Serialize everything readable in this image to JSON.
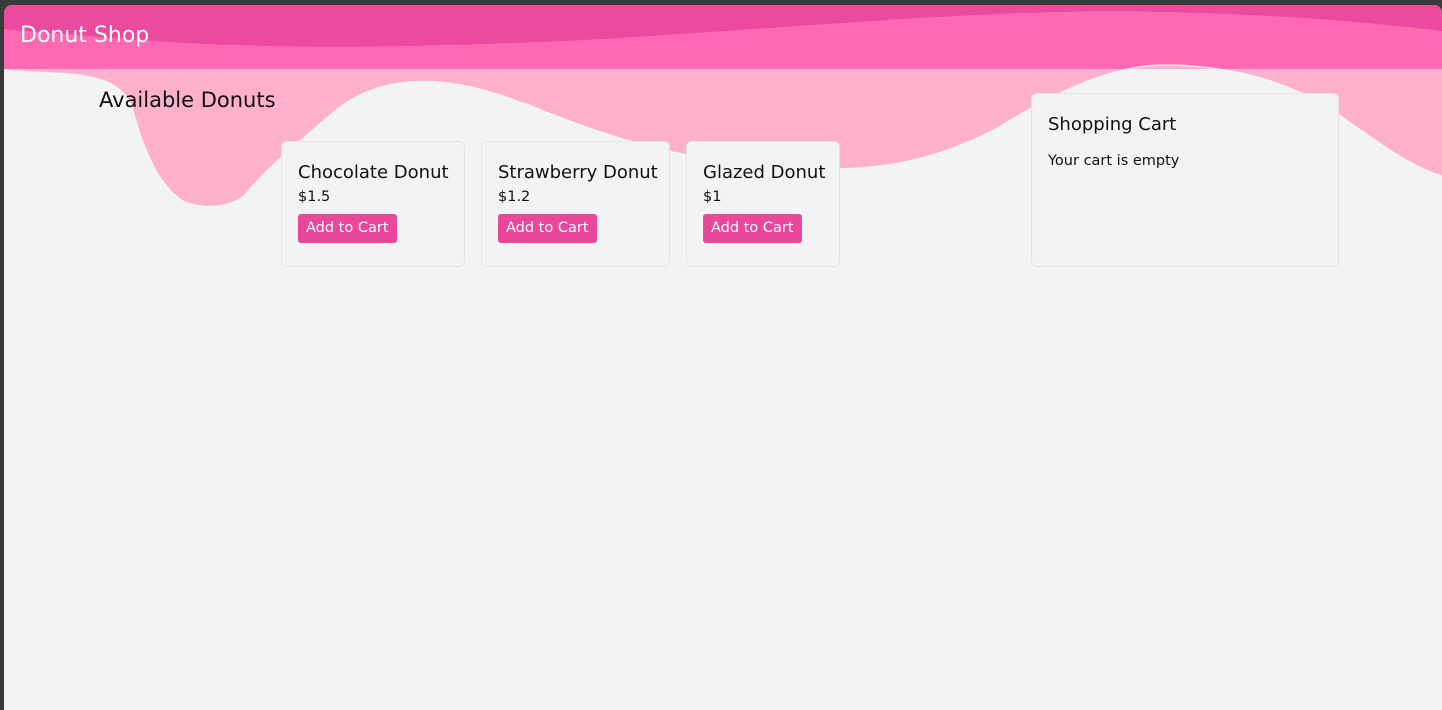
{
  "app": {
    "brand": "Donut Shop"
  },
  "theme": {
    "header_color": "#ff69b4",
    "header_dark_color": "#e8479a",
    "drip_color": "#ffb0cb",
    "button_color": "#e8479a",
    "background_color": "#f2f3f5"
  },
  "main": {
    "section_title": "Available Donuts",
    "products": [
      {
        "name": "Chocolate Donut",
        "price": "$1.5",
        "button_label": "Add to Cart"
      },
      {
        "name": "Strawberry Donut",
        "price": "$1.2",
        "button_label": "Add to Cart"
      },
      {
        "name": "Glazed Donut",
        "price": "$1",
        "button_label": "Add to Cart"
      }
    ]
  },
  "cart": {
    "title": "Shopping Cart",
    "empty_message": "Your cart is empty"
  }
}
